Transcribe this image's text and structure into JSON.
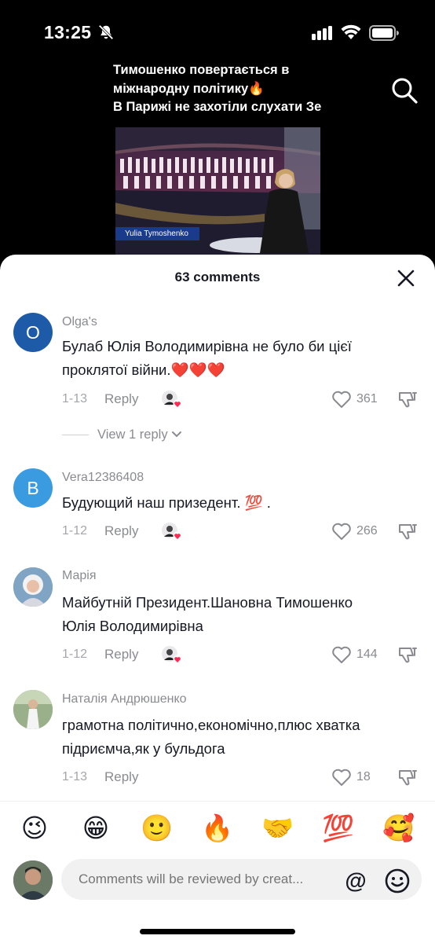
{
  "status_bar": {
    "time": "13:25"
  },
  "video": {
    "title_lines": [
      "Тимошенко повертається в",
      "міжнародну політику🔥",
      "В Парижі не захотіли слухати Зе"
    ],
    "thumbnail_caption": "Yulia Tymoshenko"
  },
  "sheet": {
    "title": "63 comments",
    "comments": [
      {
        "avatar_letter": "O",
        "avatar_color": "#1d5aa8",
        "username": "Olga's",
        "text_lines": [
          "Булаб Юлія Володимирівна не було би цієї",
          "проклятої війни.❤️❤️❤️"
        ],
        "date": "1-13",
        "reply": "Reply",
        "likes": "361"
      },
      {
        "avatar_letter": "B",
        "avatar_color": "#3b9be0",
        "username": "Vera12386408",
        "text_lines": [
          "Будующий наш призедент. 💯 ."
        ],
        "date": "1-12",
        "reply": "Reply",
        "likes": "266"
      },
      {
        "username": "Марія",
        "text_lines": [
          "Майбутній Президент.Шановна Тимошенко",
          "Юлія Володимирівна"
        ],
        "date": "1-12",
        "reply": "Reply",
        "likes": "144"
      },
      {
        "username": "Наталія Андрюшенко",
        "text_lines": [
          "грамотна політично,економічно,плюс хватка",
          "підриємча,як у бульдога"
        ],
        "date": "1-13",
        "reply": "Reply",
        "likes": "18"
      }
    ],
    "view_replies": "View 1 reply",
    "emojis": [
      "😉",
      "😁",
      "🙂",
      "🔥",
      "🤝",
      "💯",
      "🥰"
    ],
    "input_placeholder": "Comments will be reviewed by creat...",
    "mention_symbol": "@"
  },
  "colors": {
    "like_heart_badge": "#fe2c55",
    "secondary_text": "#8a8b91"
  }
}
